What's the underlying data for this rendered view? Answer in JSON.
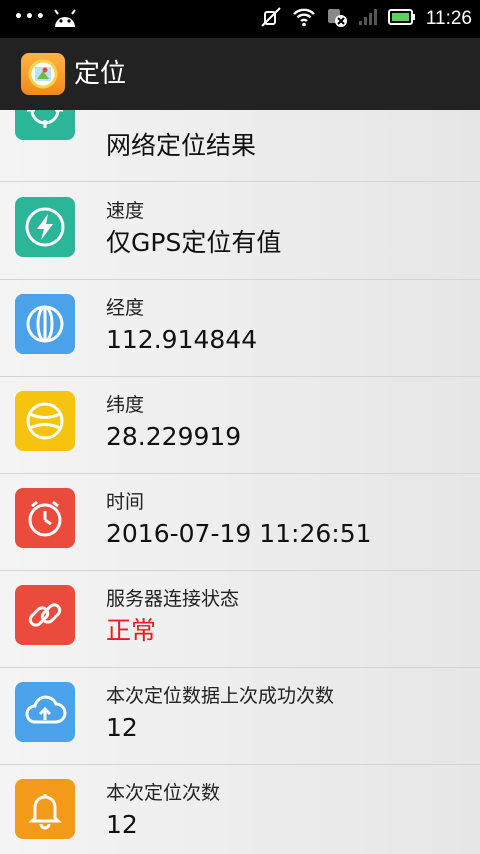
{
  "status_bar": {
    "time": "11:26"
  },
  "app_bar": {
    "title": "定位"
  },
  "rows": [
    {
      "value": "网络定位结果",
      "icon": "target-icon",
      "color": "#2bb69a"
    },
    {
      "label": "速度",
      "value": "仅GPS定位有值",
      "icon": "lightning-icon",
      "color": "#2bb69a"
    },
    {
      "label": "经度",
      "value": "112.914844",
      "icon": "globe-longitude-icon",
      "color": "#4aa3ea"
    },
    {
      "label": "纬度",
      "value": "28.229919",
      "icon": "globe-latitude-icon",
      "color": "#f6c40f"
    },
    {
      "label": "时间",
      "value": "2016-07-19 11:26:51",
      "icon": "stopwatch-icon",
      "color": "#ea4b3c"
    },
    {
      "label": "服务器连接状态",
      "value": "正常",
      "icon": "link-icon",
      "color": "#ea4b3c",
      "value_color": "#e02020"
    },
    {
      "label": "本次定位数据上次成功次数",
      "value": "12",
      "icon": "cloud-upload-icon",
      "color": "#4aa3ea"
    },
    {
      "label": "本次定位次数",
      "value": "12",
      "icon": "bell-icon",
      "color": "#f39a1b"
    }
  ]
}
